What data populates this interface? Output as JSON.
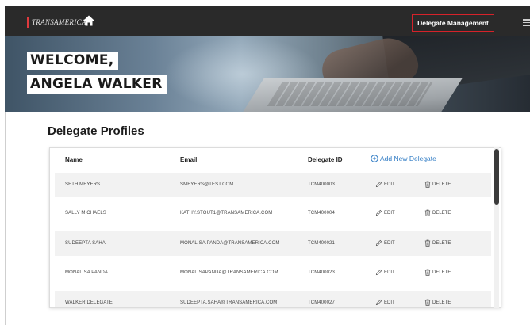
{
  "header": {
    "brand": "TRANSAMERICA",
    "nav_delegate_management": "Delegate Management",
    "icons": {
      "home": "home-icon",
      "menu": "menu-icon"
    },
    "accent_color": "#d6222a"
  },
  "hero": {
    "line1": "WELCOME,",
    "line2": "ANGELA WALKER"
  },
  "section": {
    "title": "Delegate Profiles"
  },
  "table": {
    "columns": [
      "Name",
      "Email",
      "Delegate ID"
    ],
    "add_new_label": "Add New Delegate",
    "edit_label": "EDIT",
    "delete_label": "DELETE",
    "rows": [
      {
        "name": "SETH MEYERS",
        "email": "SMEYERS@TEST.COM",
        "delegate_id": "TCM400003"
      },
      {
        "name": "SALLY MICHAELS",
        "email": "KATHY.STOUT1@TRANSAMERICA.COM",
        "delegate_id": "TCM400004"
      },
      {
        "name": "SUDEEPTA SAHA",
        "email": "MONALISA.PANDA@TRANSAMERICA.COM",
        "delegate_id": "TCM400021"
      },
      {
        "name": "MONALISA PANDA",
        "email": "MONALISAPANDA@TRANSAMERICA.COM",
        "delegate_id": "TCM400023"
      },
      {
        "name": "WALKER DELEGATE",
        "email": "SUDEEPTA.SAHA@TRANSAMERICA.COM",
        "delegate_id": "TCM400027"
      }
    ],
    "link_color": "#2f7bc4"
  }
}
